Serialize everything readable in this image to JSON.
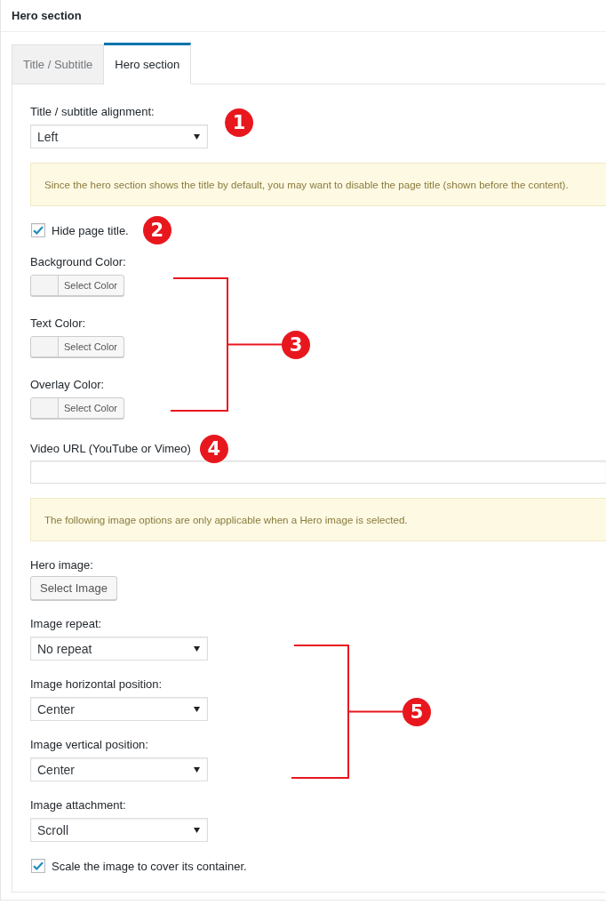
{
  "panel": {
    "title": "Hero section"
  },
  "tabs": [
    {
      "label": "Title / Subtitle",
      "selected": false
    },
    {
      "label": "Hero section",
      "selected": true
    }
  ],
  "form": [
    {
      "kind": "select",
      "label": "Title / subtitle alignment:",
      "value": "Left",
      "callout": "1"
    },
    {
      "kind": "notice",
      "text": "Since the hero section shows the title by default, you may want to disable the page title (shown before the content)."
    },
    {
      "kind": "checkbox",
      "label": "Hide page title.",
      "checked": true,
      "callout": "2"
    },
    {
      "kind": "group",
      "callout": "3",
      "items": [
        {
          "kind": "color",
          "label": "Background Color:",
          "button": "Select Color"
        },
        {
          "kind": "color",
          "label": "Text Color:",
          "button": "Select Color"
        },
        {
          "kind": "color",
          "label": "Overlay Color:",
          "button": "Select Color"
        }
      ]
    },
    {
      "kind": "text",
      "label": "Video URL (YouTube or Vimeo)",
      "callout": "4"
    },
    {
      "kind": "notice",
      "text": "The following image options are only applicable when a Hero image is selected."
    },
    {
      "kind": "image",
      "label": "Hero image:",
      "button": "Select Image"
    },
    {
      "kind": "group",
      "callout": "5",
      "items": [
        {
          "kind": "select",
          "label": "Image repeat:",
          "value": "No repeat"
        },
        {
          "kind": "select",
          "label": "Image horizontal position:",
          "value": "Center"
        },
        {
          "kind": "select",
          "label": "Image vertical position:",
          "value": "Center"
        }
      ]
    },
    {
      "kind": "select",
      "label": "Image attachment:",
      "value": "Scroll"
    },
    {
      "kind": "checkbox",
      "label": "Scale the image to cover its container.",
      "checked": true
    }
  ]
}
